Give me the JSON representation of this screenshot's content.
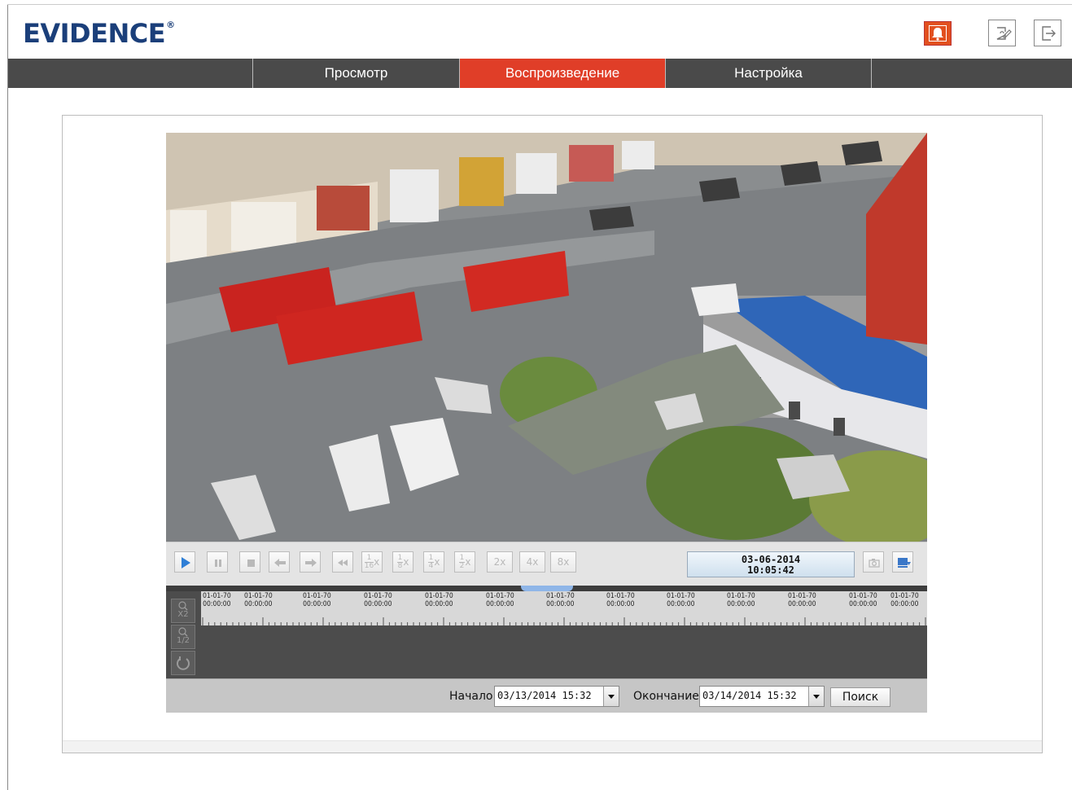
{
  "brand": {
    "logo_text": "EVIDENCE",
    "logo_mark": "®",
    "color": "#1b3f7a"
  },
  "header_icons": {
    "alarm": "bell-icon",
    "account": "user-edit-icon",
    "logout": "logout-icon"
  },
  "nav": {
    "tabs": [
      {
        "label": "Просмотр",
        "active": false
      },
      {
        "label": "Воспроизведение",
        "active": true
      },
      {
        "label": "Настройка",
        "active": false
      }
    ],
    "accent": "#e03e28"
  },
  "video": {
    "content": "aerial camera view of parking area with fire trucks, ambulances and crowd"
  },
  "controls": {
    "buttons": [
      "play-icon",
      "pause-icon",
      "stop-icon",
      "step-back-icon",
      "step-forward-icon",
      "rewind-icon"
    ],
    "speeds": {
      "s16": {
        "num": "1",
        "den": "16",
        "suffix": "x"
      },
      "s8": {
        "num": "1",
        "den": "8",
        "suffix": "x"
      },
      "s4": {
        "num": "1",
        "den": "4",
        "suffix": "x"
      },
      "s2": {
        "num": "1",
        "den": "2",
        "suffix": "x"
      },
      "x2": "2x",
      "x4": "4x",
      "x8": "8x"
    },
    "date": "03-06-2014",
    "time": "10:05:42"
  },
  "timeline": {
    "marks": [
      [
        "01-01-70",
        "00:00:00"
      ],
      [
        "01-01-70",
        "00:00:00"
      ],
      [
        "01-01-70",
        "00:00:00"
      ],
      [
        "01-01-70",
        "00:00:00"
      ],
      [
        "01-01-70",
        "00:00:00"
      ],
      [
        "01-01-70",
        "00:00:00"
      ],
      [
        "01-01-70",
        "00:00:00"
      ],
      [
        "01-01-70",
        "00:00:00"
      ],
      [
        "01-01-70",
        "00:00:00"
      ],
      [
        "01-01-70",
        "00:00:00"
      ],
      [
        "01-01-70",
        "00:00:00"
      ],
      [
        "01-01-70",
        "00:00:00"
      ],
      [
        "01-01-70",
        "00:00:00"
      ]
    ],
    "zoom_in": {
      "lines": [
        "X2"
      ]
    },
    "zoom_out": {
      "lines": [
        "1/2"
      ]
    }
  },
  "search": {
    "start_label": "Начало",
    "start_value": "03/13/2014 15:32",
    "end_label": "Окончание",
    "end_value": "03/14/2014 15:32",
    "button": "Поиск"
  }
}
